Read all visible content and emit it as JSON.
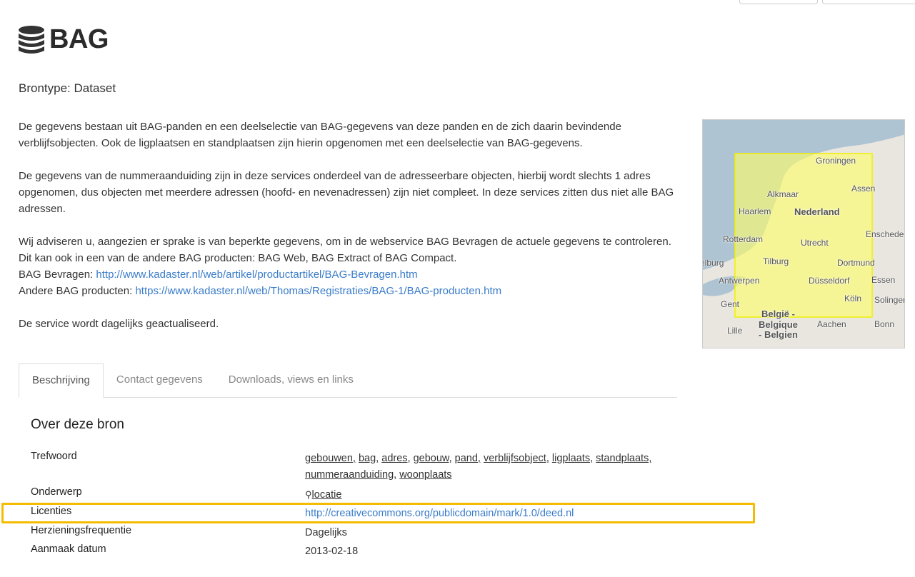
{
  "header": {
    "title": "BAG",
    "icon": "database-icon",
    "brontype": "Brontype: Dataset"
  },
  "description": {
    "p1": "De gegevens bestaan uit BAG-panden en een deelselectie van BAG-gegevens van deze panden en de zich daarin bevindende verblijfsobjecten. Ook de ligplaatsen en standplaatsen zijn hierin opgenomen met een deelselectie van BAG-gegevens.",
    "p2": "De gegevens van de nummeraanduiding zijn in deze services onderdeel van de adresseerbare objecten, hierbij wordt slechts 1 adres opgenomen, dus objecten met meerdere adressen (hoofd- en nevenadressen) zijn niet compleet. In deze services zitten dus niet alle BAG adressen.",
    "p3": "Wij adviseren u, aangezien er sprake is van beperkte gegevens, om in de webservice BAG Bevragen de actuele gegevens te controleren. Dit kan ook in een van de andere BAG producten: BAG Web, BAG Extract of BAG Compact.",
    "bevragen_label": "BAG Bevragen: ",
    "bevragen_link": "http://www.kadaster.nl/web/artikel/productartikel/BAG-Bevragen.htm",
    "andere_label": "Andere BAG producten: ",
    "andere_link": "https://www.kadaster.nl/web/Thomas/Registraties/BAG-1/BAG-producten.htm",
    "p4": "De service wordt dagelijks geactualiseerd."
  },
  "map": {
    "labels": [
      "Groningen",
      "Assen",
      "Alkmaar",
      "Haarlem",
      "Nederland",
      "Enschede",
      "Rotterdam",
      "Utrecht",
      "Middelburg",
      "Tilburg",
      "Dortmund",
      "Essen",
      "Antwerpen",
      "Düsseldorf",
      "Gent",
      "Köln",
      "Solingen",
      "België -",
      "Belgique",
      "- Belgien",
      "Aachen",
      "Bonn",
      "Lille"
    ]
  },
  "tabs": [
    {
      "label": "Beschrijving",
      "active": true
    },
    {
      "label": "Contact gegevens"
    },
    {
      "label": "Downloads, views en links"
    }
  ],
  "section": {
    "title": "Over deze bron",
    "rows": {
      "trefwoord": {
        "label": "Trefwoord",
        "keywords": [
          "gebouwen,",
          "bag,",
          "adres,",
          "gebouw,",
          "pand,",
          "verblijfsobject,",
          "ligplaats,",
          "standplaats,",
          "nummeraanduiding,",
          "woonplaats"
        ]
      },
      "onderwerp": {
        "label": "Onderwerp",
        "value": "locatie"
      },
      "licenties": {
        "label": "Licenties",
        "value": "http://creativecommons.org/publicdomain/mark/1.0/deed.nl"
      },
      "herziening": {
        "label": "Herzieningsfrequentie",
        "value": "Dagelijks"
      },
      "aanmaak": {
        "label": "Aanmaak datum",
        "value": "2013-02-18"
      }
    }
  },
  "colors": {
    "link": "#3a7cc9",
    "highlight": "#f5bb00",
    "bbox": "#ffff66"
  }
}
